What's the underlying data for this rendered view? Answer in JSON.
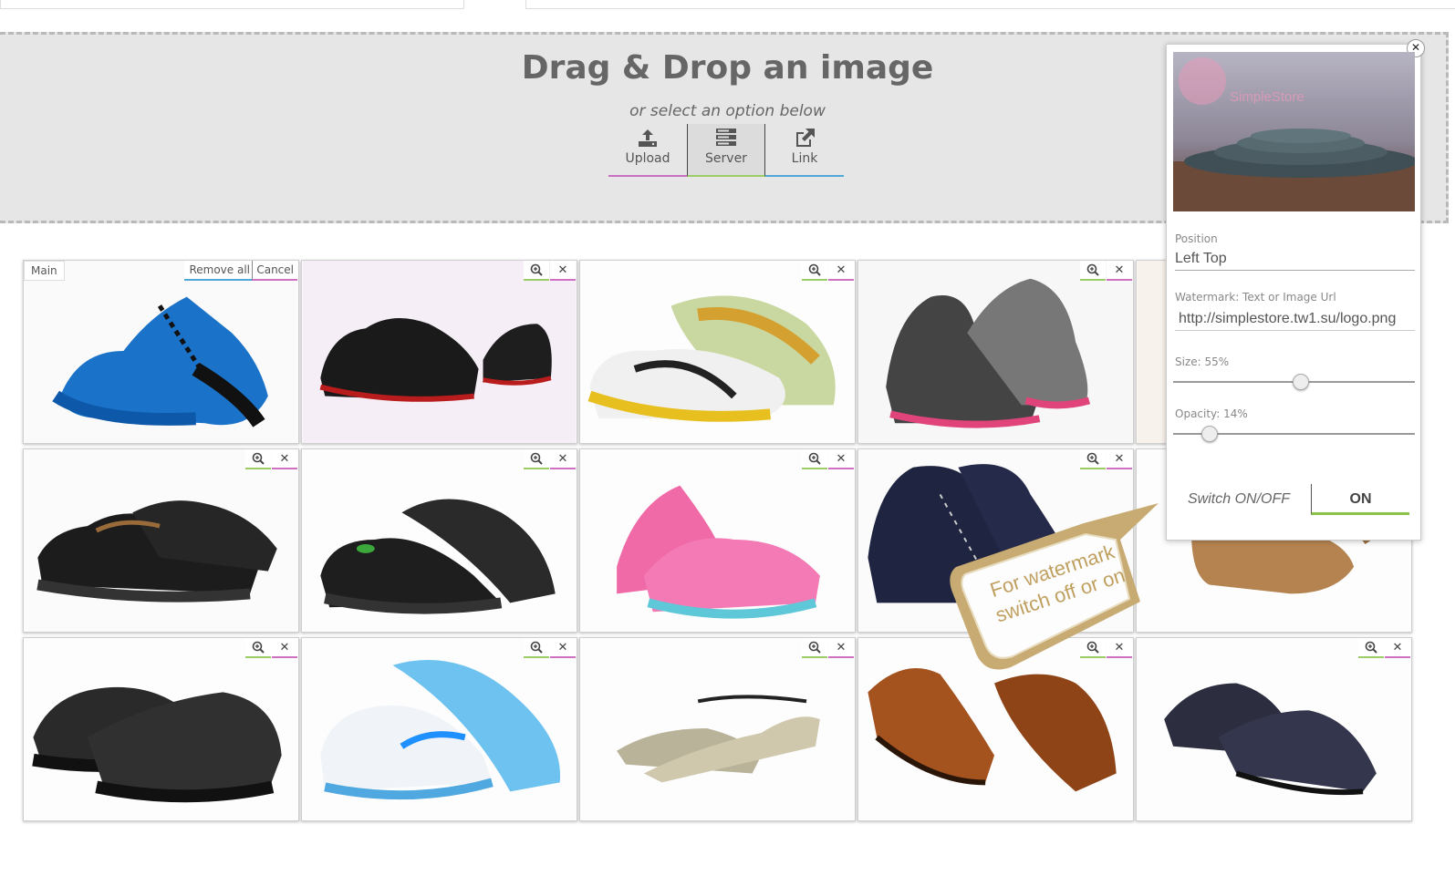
{
  "dropzone": {
    "title": "Drag & Drop an image",
    "subtitle": "or select an option below",
    "options": [
      {
        "label": "Upload",
        "icon": "upload-icon"
      },
      {
        "label": "Server",
        "icon": "server-icon"
      },
      {
        "label": "Link",
        "icon": "external-link-icon"
      }
    ]
  },
  "gallery": {
    "main_label": "Main",
    "remove_all_label": "Remove all",
    "cancel_label": "Cancel",
    "zoom_icon": "zoom-in-icon",
    "delete_icon": "close-icon"
  },
  "watermark_panel": {
    "preview_logo_text": "SimpleStore",
    "position_label": "Position",
    "position_value": "Left Top",
    "watermark_label": "Watermark: Text or Image Url",
    "watermark_value": "http://simplestore.tw1.su/logo.png",
    "size_label": "Size: 55%",
    "size_value": 55,
    "opacity_label": "Opacity: 14%",
    "opacity_value": 14,
    "switch_label": "Switch ON/OFF",
    "switch_state": "ON"
  },
  "callout": {
    "text_line1": "For watermark",
    "text_line2": "switch off or on"
  },
  "colors": {
    "accent_pink": "#d070c0",
    "accent_green": "#9ccc65",
    "accent_blue": "#4fa8d8",
    "callout_gold": "#c0a060"
  }
}
